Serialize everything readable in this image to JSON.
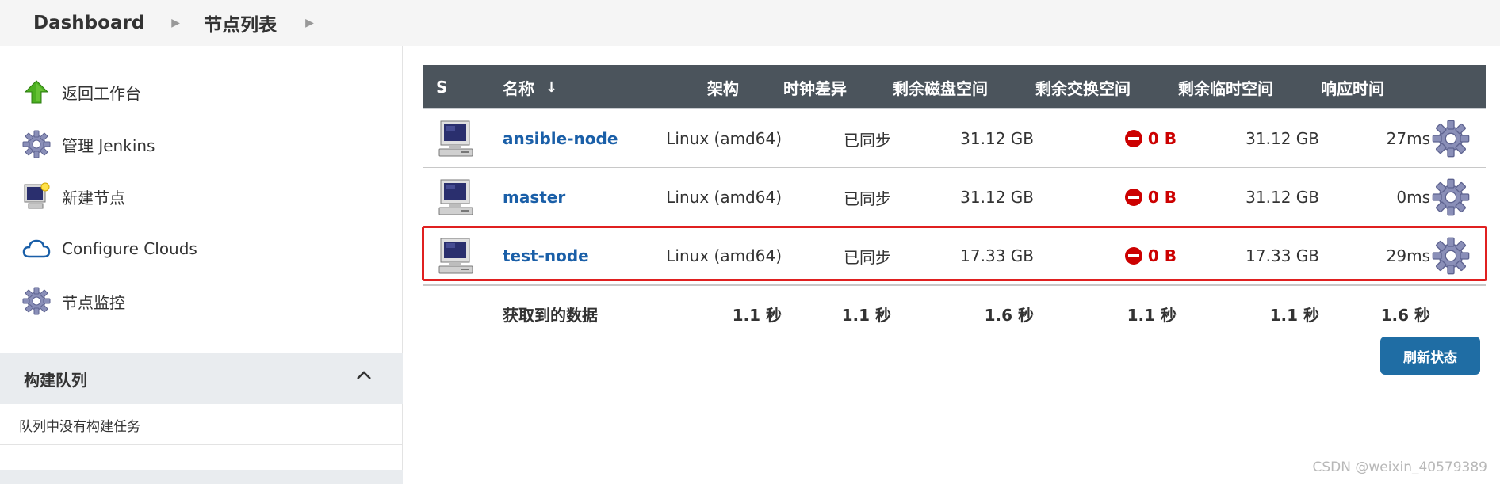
{
  "breadcrumb": {
    "items": [
      "Dashboard",
      "节点列表"
    ]
  },
  "sidebar": {
    "items": [
      {
        "label": "返回工作台",
        "icon": "up-arrow-icon"
      },
      {
        "label": "管理 Jenkins",
        "icon": "gear-icon"
      },
      {
        "label": "新建节点",
        "icon": "computer-new-icon"
      },
      {
        "label": "Configure Clouds",
        "icon": "cloud-icon"
      },
      {
        "label": "节点监控",
        "icon": "gear-icon"
      }
    ],
    "queue": {
      "title": "构建队列",
      "empty_text": "队列中没有构建任务"
    }
  },
  "table": {
    "headers": {
      "s": "S",
      "name": "名称",
      "sort_arrow": "↓",
      "arch": "架构",
      "clock": "时钟差异",
      "disk": "剩余磁盘空间",
      "swap": "剩余交换空间",
      "tmp": "剩余临时空间",
      "resp": "响应时间"
    },
    "rows": [
      {
        "name": "ansible-node",
        "arch": "Linux (amd64)",
        "clock": "已同步",
        "disk": "31.12 GB",
        "swap": "0 B",
        "tmp": "31.12 GB",
        "resp": "27ms",
        "highlighted": false
      },
      {
        "name": "master",
        "arch": "Linux (amd64)",
        "clock": "已同步",
        "disk": "31.12 GB",
        "swap": "0 B",
        "tmp": "31.12 GB",
        "resp": "0ms",
        "highlighted": false
      },
      {
        "name": "test-node",
        "arch": "Linux (amd64)",
        "clock": "已同步",
        "disk": "17.33 GB",
        "swap": "0 B",
        "tmp": "17.33 GB",
        "resp": "29ms",
        "highlighted": true
      }
    ],
    "summary": {
      "label": "获取到的数据",
      "arch": "1.1 秒",
      "clock": "1.1 秒",
      "disk": "1.6 秒",
      "swap": "1.1 秒",
      "tmp": "1.1 秒",
      "resp": "1.6 秒"
    }
  },
  "refresh_label": "刷新状态",
  "watermark": "CSDN @weixin_40579389",
  "colors": {
    "header_bg": "#4b545c",
    "link": "#1a5fa8",
    "error": "#cc0000",
    "button": "#1f6da4",
    "highlight": "#e02020"
  }
}
